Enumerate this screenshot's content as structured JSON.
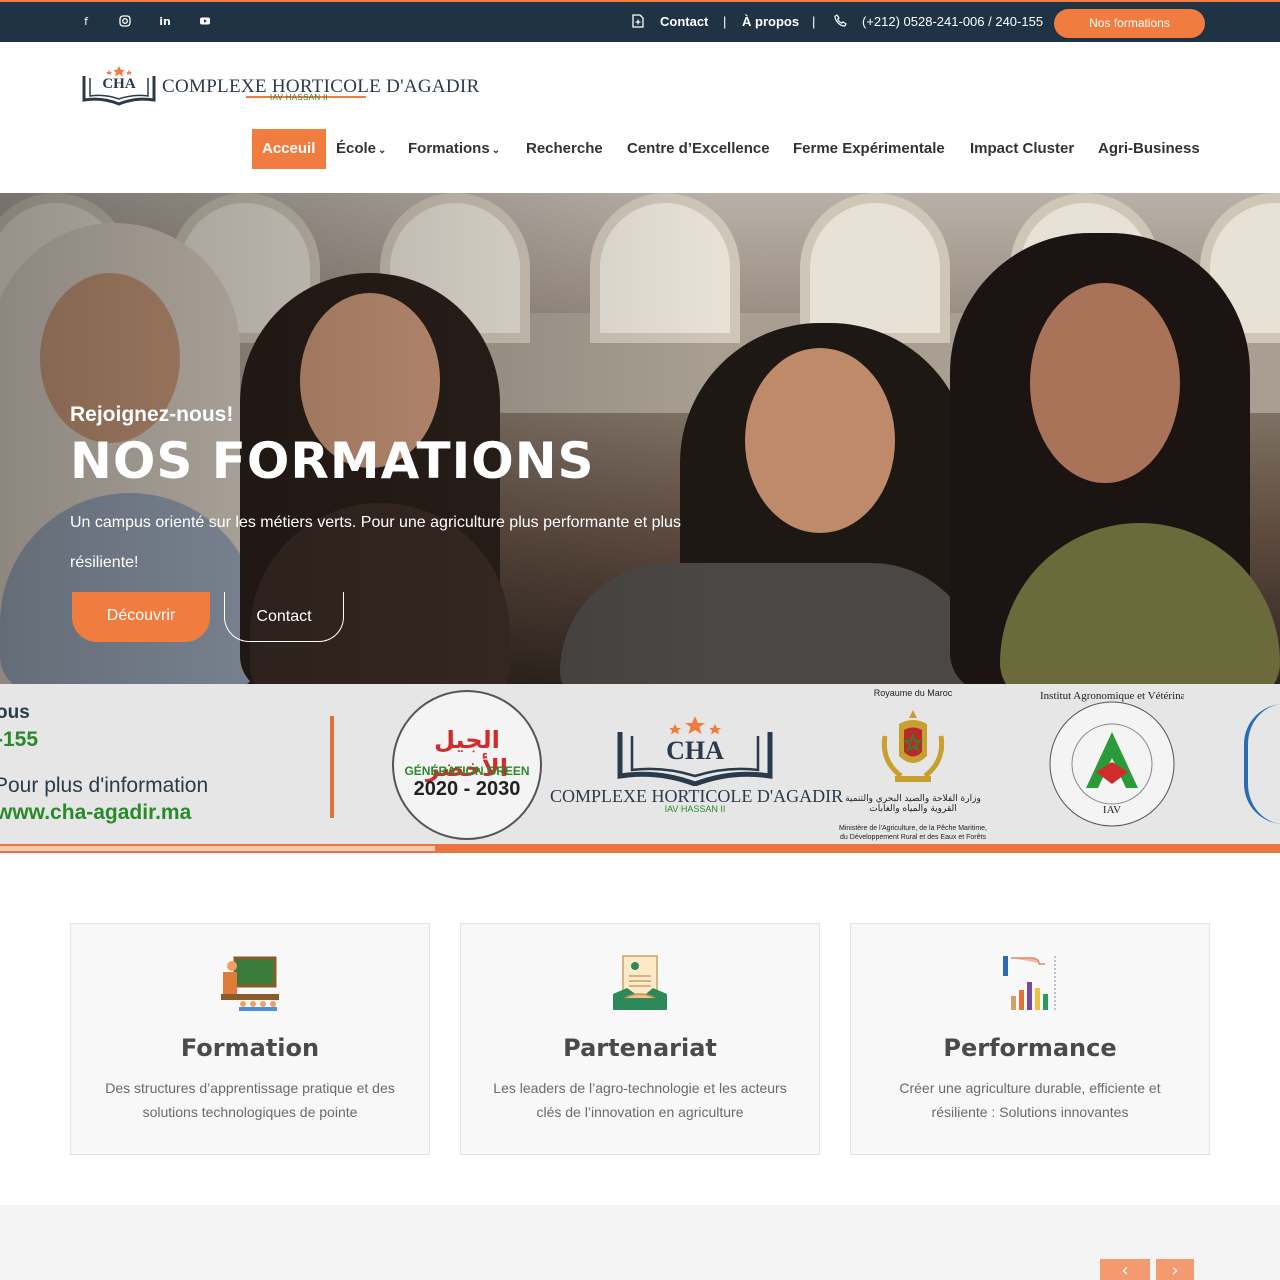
{
  "topbar": {
    "social_icons": [
      "facebook-icon",
      "instagram-icon",
      "linkedin-icon",
      "youtube-icon"
    ],
    "contact_label": "Contact",
    "separator": "|",
    "about_label": "À propos",
    "phone": "(+212) 0528-241-006 / 240-155",
    "cta_label": "Nos formations"
  },
  "header": {
    "logo_mark": "CHA",
    "logo_title": "COMPLEXE HORTICOLE D'AGADIR",
    "logo_subtitle": "IAV HASSAN II",
    "nav": [
      {
        "label": "Acceuil",
        "active": true
      },
      {
        "label": "École",
        "dropdown": true
      },
      {
        "label": "Formations",
        "dropdown": true
      },
      {
        "label": "Recherche"
      },
      {
        "label": "Centre d’Excellence"
      },
      {
        "label": "Ferme Expérimentale"
      },
      {
        "label": "Impact Cluster"
      },
      {
        "label": "Agri-Business"
      }
    ]
  },
  "hero": {
    "kicker": "Rejoignez-nous!",
    "title": "NOS FORMATIONS",
    "description": "Un campus orienté sur les métiers verts. Pour une agriculture plus performante et plus résiliente!",
    "primary_button": "Découvrir",
    "secondary_button": "Contact"
  },
  "partners": {
    "phone_fragment_top": "ous",
    "phone_fragment": "-155",
    "info_label": "Pour plus d'information",
    "website": "www.cha-agadir.ma",
    "generation_green_ar": "الجيل الأخضر",
    "generation_green": "GÉNÉRATION GREEN",
    "generation_years": "2020 - 2030",
    "cha_mark": "CHA",
    "cha_title": "COMPLEXE HORTICOLE D'AGADIR",
    "cha_subtitle": "IAV HASSAN II",
    "kingdom": "Royaume du Maroc",
    "ministry_ar": "وزارة الفلاحة والصيد البحري والتنمية القروية والمياه والغابات",
    "ministry_fr": "Ministère de l'Agriculture, de la Pêche Maritime, du Développement Rural et des Eaux et Forêts",
    "iav_text": "Institut Agronomique et Vétérinaire Hassan II",
    "iav_abbr": "IAV",
    "slider_progress": 0.34
  },
  "features": [
    {
      "icon": "teacher-board-icon",
      "title": "Formation",
      "description": "Des structures d’apprentissage pratique et des solutions technologiques de pointe"
    },
    {
      "icon": "partnership-contract-icon",
      "title": "Partenariat",
      "description": "Les leaders de l’agro-technologie et les acteurs clés de l’innovation en agriculture"
    },
    {
      "icon": "performance-chart-icon",
      "title": "Performance",
      "description": "Créer une agriculture durable, efficiente et résiliente : Solutions innovantes"
    }
  ],
  "carousel": {
    "prev_icon": "chevron-left-icon",
    "next_icon": "chevron-right-icon"
  },
  "colors": {
    "accent": "#f07d3f",
    "topbar": "#1f3345",
    "heading": "#4a4a4a"
  }
}
